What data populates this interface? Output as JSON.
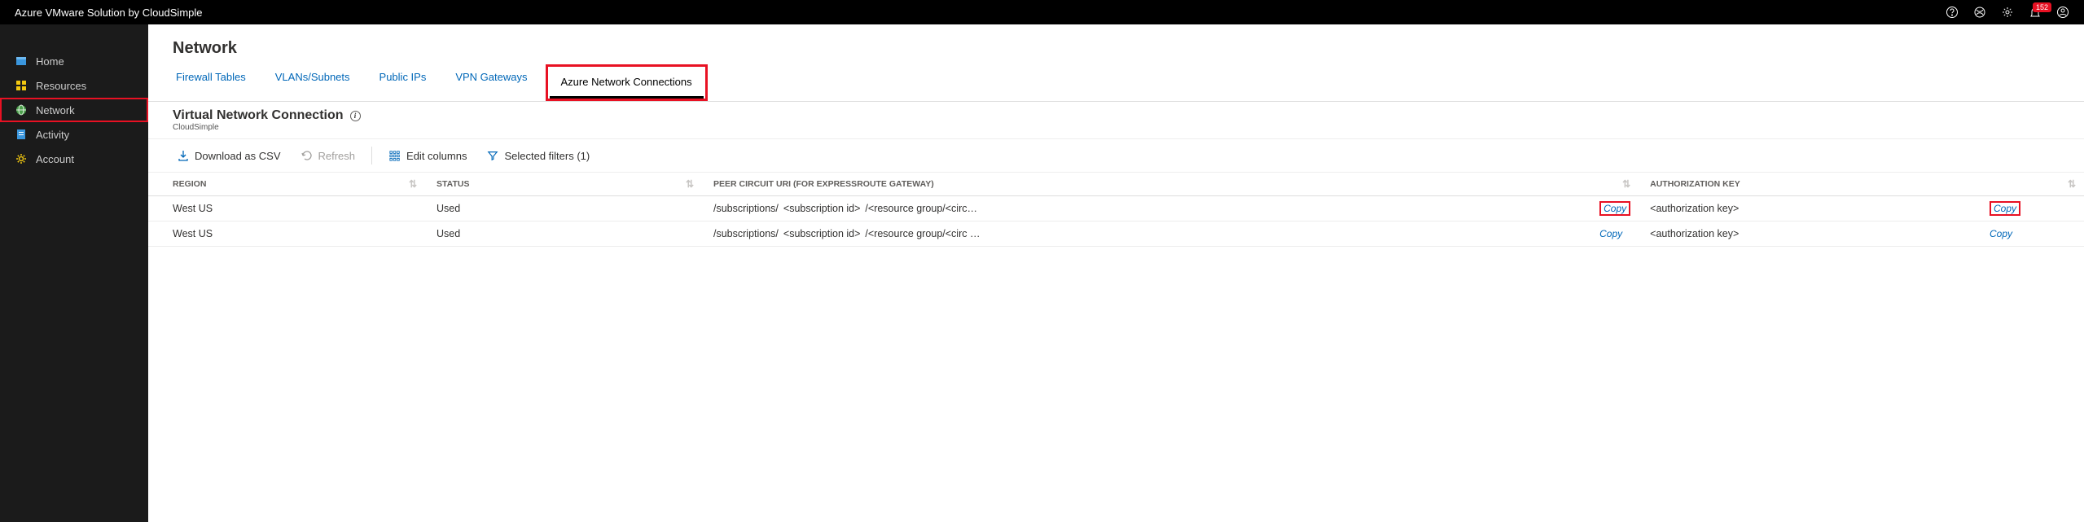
{
  "topbar": {
    "title": "Azure VMware Solution by CloudSimple",
    "notification_count": "152"
  },
  "sidebar": {
    "items": [
      {
        "label": "Home"
      },
      {
        "label": "Resources"
      },
      {
        "label": "Network"
      },
      {
        "label": "Activity"
      },
      {
        "label": "Account"
      }
    ]
  },
  "page": {
    "title": "Network",
    "tabs": [
      {
        "label": "Firewall Tables"
      },
      {
        "label": "VLANs/Subnets"
      },
      {
        "label": "Public IPs"
      },
      {
        "label": "VPN Gateways"
      },
      {
        "label": "Azure Network Connections"
      }
    ],
    "section_title": "Virtual Network Connection",
    "section_sub": "CloudSimple",
    "toolbar": {
      "download": "Download as CSV",
      "refresh": "Refresh",
      "edit_cols": "Edit columns",
      "filters": "Selected filters (1)"
    },
    "table": {
      "headers": {
        "region": "REGION",
        "status": "STATUS",
        "uri": "PEER CIRCUIT URI (FOR EXPRESSROUTE GATEWAY)",
        "auth": "AUTHORIZATION KEY"
      },
      "copy_label": "Copy",
      "rows": [
        {
          "region": "West US",
          "status": "Used",
          "uri_prefix": "/subscriptions/",
          "uri_mid": "<subscription id>",
          "uri_suffix": "/<resource group/<circ…",
          "auth": "<authorization key>"
        },
        {
          "region": "West US",
          "status": "Used",
          "uri_prefix": "/subscriptions/",
          "uri_mid": "<subscription id>",
          "uri_suffix": "/<resource group/<circ …",
          "auth": "<authorization key>"
        }
      ]
    }
  }
}
